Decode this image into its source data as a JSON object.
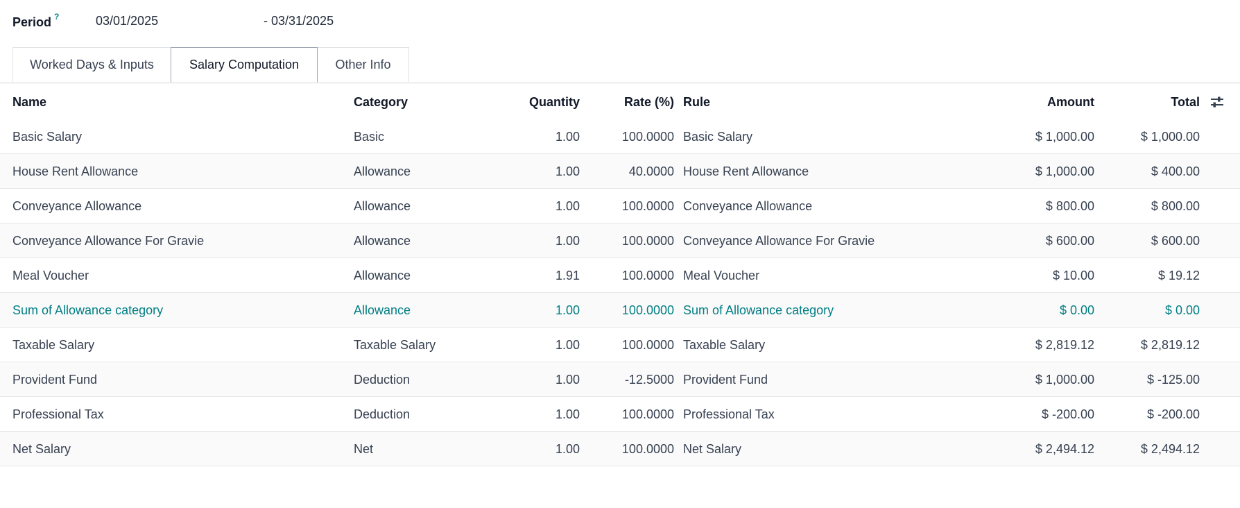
{
  "period": {
    "label": "Period",
    "help": "?",
    "start": "03/01/2025",
    "end": "- 03/31/2025"
  },
  "tabs": [
    {
      "label": "Worked Days & Inputs",
      "active": false
    },
    {
      "label": "Salary Computation",
      "active": true
    },
    {
      "label": "Other Info",
      "active": false
    }
  ],
  "table": {
    "columns": {
      "name": "Name",
      "category": "Category",
      "quantity": "Quantity",
      "rate": "Rate (%)",
      "rule": "Rule",
      "amount": "Amount",
      "total": "Total"
    },
    "settings_icon": "sliders-icon",
    "rows": [
      {
        "name": "Basic Salary",
        "category": "Basic",
        "quantity": "1.00",
        "rate": "100.0000",
        "rule": "Basic Salary",
        "amount": "$ 1,000.00",
        "total": "$ 1,000.00"
      },
      {
        "name": "House Rent Allowance",
        "category": "Allowance",
        "quantity": "1.00",
        "rate": "40.0000",
        "rule": "House Rent Allowance",
        "amount": "$ 1,000.00",
        "total": "$ 400.00"
      },
      {
        "name": "Conveyance Allowance",
        "category": "Allowance",
        "quantity": "1.00",
        "rate": "100.0000",
        "rule": "Conveyance Allowance",
        "amount": "$ 800.00",
        "total": "$ 800.00"
      },
      {
        "name": "Conveyance Allowance For Gravie",
        "category": "Allowance",
        "quantity": "1.00",
        "rate": "100.0000",
        "rule": "Conveyance Allowance For Gravie",
        "amount": "$ 600.00",
        "total": "$ 600.00"
      },
      {
        "name": "Meal Voucher",
        "category": "Allowance",
        "quantity": "1.91",
        "rate": "100.0000",
        "rule": "Meal Voucher",
        "amount": "$ 10.00",
        "total": "$ 19.12"
      },
      {
        "name": "Sum of Allowance category",
        "category": "Allowance",
        "quantity": "1.00",
        "rate": "100.0000",
        "rule": "Sum of Allowance category",
        "amount": "$ 0.00",
        "total": "$ 0.00",
        "highlight": true
      },
      {
        "name": "Taxable Salary",
        "category": "Taxable Salary",
        "quantity": "1.00",
        "rate": "100.0000",
        "rule": "Taxable Salary",
        "amount": "$ 2,819.12",
        "total": "$ 2,819.12"
      },
      {
        "name": "Provident Fund",
        "category": "Deduction",
        "quantity": "1.00",
        "rate": "-12.5000",
        "rule": "Provident Fund",
        "amount": "$ 1,000.00",
        "total": "$ -125.00"
      },
      {
        "name": "Professional Tax",
        "category": "Deduction",
        "quantity": "1.00",
        "rate": "100.0000",
        "rule": "Professional Tax",
        "amount": "$ -200.00",
        "total": "$ -200.00"
      },
      {
        "name": "Net Salary",
        "category": "Net",
        "quantity": "1.00",
        "rate": "100.0000",
        "rule": "Net Salary",
        "amount": "$ 2,494.12",
        "total": "$ 2,494.12"
      }
    ]
  },
  "colors": {
    "accent": "#017e84",
    "text": "#374151",
    "border": "#e5e7eb"
  }
}
